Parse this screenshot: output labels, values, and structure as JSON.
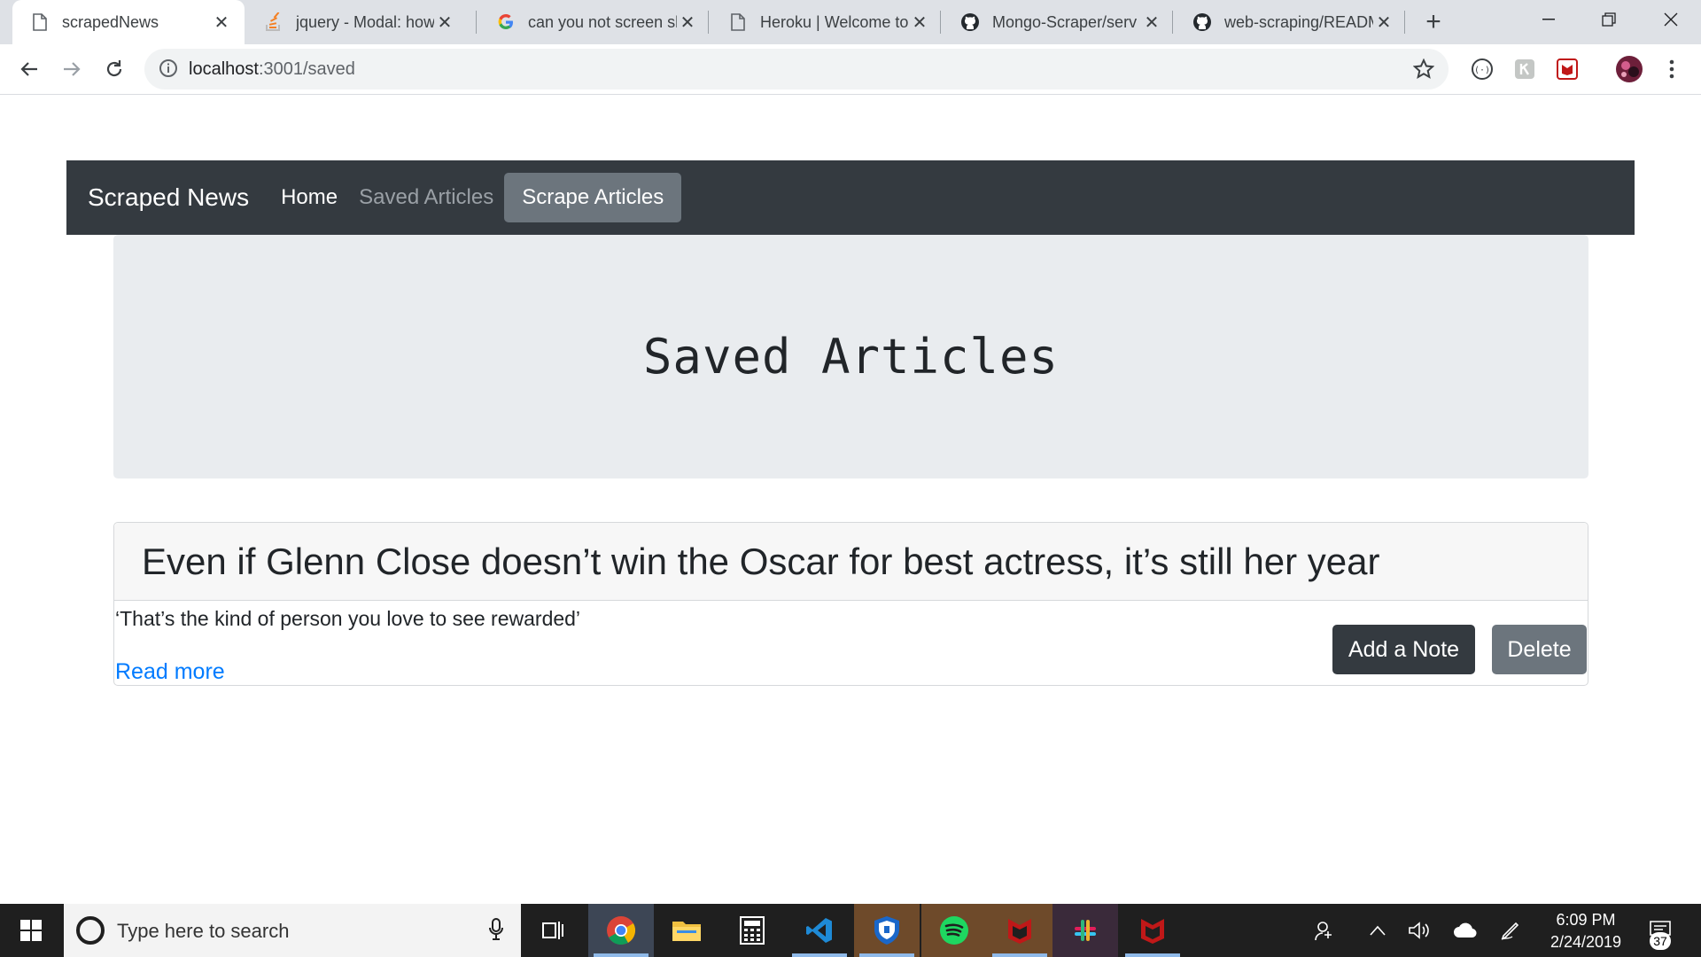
{
  "browser": {
    "tabs": [
      {
        "title": "scrapedNews",
        "icon": "page-icon",
        "active": true
      },
      {
        "title": "jquery - Modal: how",
        "icon": "stackoverflow-icon",
        "active": false
      },
      {
        "title": "can you not screen sh",
        "icon": "google-icon",
        "active": false
      },
      {
        "title": "Heroku | Welcome to",
        "icon": "page-icon",
        "active": false
      },
      {
        "title": "Mongo-Scraper/serv",
        "icon": "github-icon",
        "active": false
      },
      {
        "title": "web-scraping/READM",
        "icon": "github-icon",
        "active": false
      }
    ],
    "new_tab": "+",
    "url_host": "localhost",
    "url_path": ":3001/saved"
  },
  "navbar": {
    "brand": "Scraped News",
    "links": [
      "Home",
      "Saved Articles"
    ],
    "scrape_button": "Scrape Articles"
  },
  "jumbotron": {
    "title": "Saved Articles"
  },
  "article": {
    "headline": "Even if Glenn Close doesn’t win the Oscar for best actress, it’s still her year",
    "summary": "‘That’s the kind of person you love to see rewarded’",
    "read_more": "Read more",
    "note_button": "Add a Note",
    "delete_button": "Delete"
  },
  "taskbar": {
    "search_placeholder": "Type here to search",
    "time": "6:09 PM",
    "date": "2/24/2019",
    "notification_count": "37"
  },
  "colors": {
    "navbar_bg": "#343a40",
    "jumbotron_bg": "#e9ecef",
    "link": "#007bff",
    "secondary_button": "#6c757d"
  }
}
